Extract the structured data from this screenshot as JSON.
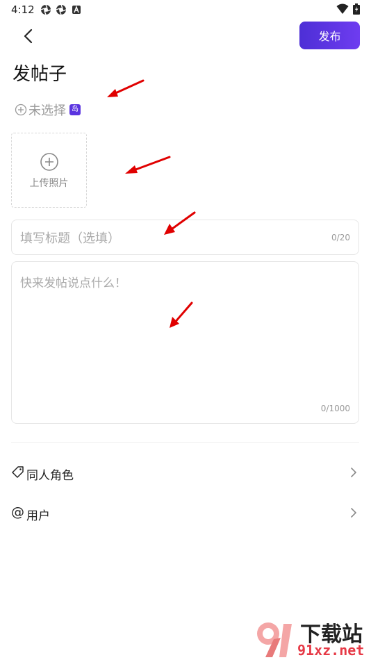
{
  "status_bar": {
    "time": "4:12",
    "left_icons": [
      "aperture-icon",
      "aperture-icon",
      "app-a-icon"
    ],
    "right_icons": [
      "wifi-icon",
      "battery-charging-icon"
    ]
  },
  "header": {
    "back_icon": "chevron-left-icon",
    "publish_label": "发布",
    "publish_color_start": "#4d2fd6",
    "publish_color_end": "#6e3cf0"
  },
  "page_title": "发帖子",
  "island_select": {
    "icon": "plus-circle-icon",
    "label": "未选择",
    "badge": "岛"
  },
  "upload": {
    "icon": "plus-circle-icon",
    "label": "上传照片"
  },
  "title_field": {
    "placeholder": "填写标题（选填）",
    "value": "",
    "counter": "0/20"
  },
  "body_field": {
    "placeholder": "快来发帖说点什么！",
    "value": "",
    "counter": "0/1000"
  },
  "options": [
    {
      "icon": "tag-icon",
      "label": "同人角色"
    },
    {
      "icon": "at-icon",
      "label": "用户",
      "symbol": "@"
    }
  ],
  "watermark": {
    "line1": "下载站",
    "line2": "91xz.net"
  },
  "colors": {
    "accent": "#5a34e0",
    "annotation_arrow": "#e00000"
  }
}
